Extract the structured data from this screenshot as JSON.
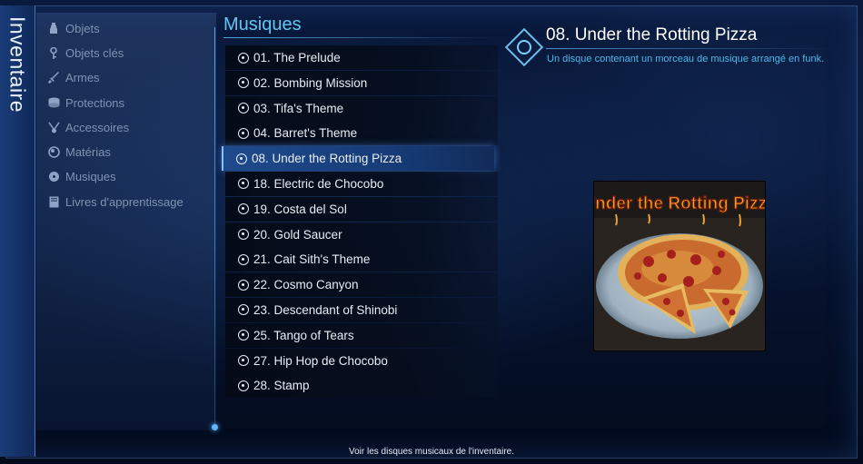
{
  "side_title": "Inventaire",
  "categories": [
    {
      "label": "Objets",
      "icon": "potion-icon"
    },
    {
      "label": "Objets clés",
      "icon": "key-icon"
    },
    {
      "label": "Armes",
      "icon": "sword-icon"
    },
    {
      "label": "Protections",
      "icon": "armor-icon"
    },
    {
      "label": "Accessoires",
      "icon": "accessory-icon"
    },
    {
      "label": "Matérias",
      "icon": "materia-icon"
    },
    {
      "label": "Musiques",
      "icon": "music-disc-icon"
    },
    {
      "label": "Livres d'apprentissage",
      "icon": "book-icon"
    }
  ],
  "section_title": "Musiques",
  "tracks": [
    "01. The Prelude",
    "02. Bombing Mission",
    "03. Tifa's Theme",
    "04. Barret's Theme",
    "08. Under the Rotting Pizza",
    "18. Electric de Chocobo",
    "19. Costa del Sol",
    "20. Gold Saucer",
    "21. Cait Sith's Theme",
    "22. Cosmo Canyon",
    "23. Descendant of Shinobi",
    "25. Tango of Tears",
    "27. Hip Hop de Chocobo",
    "28. Stamp"
  ],
  "selected_index": 4,
  "detail": {
    "title": "08. Under the Rotting Pizza",
    "description": "Un disque contenant un morceau de musique arrangé en funk.",
    "cover_text": "Under the Rotting Pizza"
  },
  "footer_hint": "Voir les disques musicaux de l'inventaire."
}
